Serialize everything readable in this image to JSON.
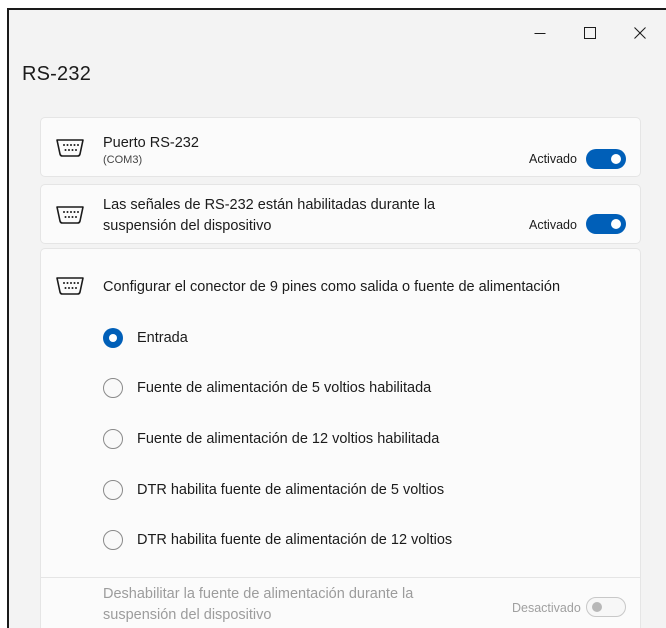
{
  "titlebar": {
    "minimize_glyph": "—",
    "maximize_glyph": "☐",
    "close_glyph": "✕"
  },
  "page": {
    "title": "RS-232"
  },
  "settings": [
    {
      "icon": "serial-port-icon",
      "title": "Puerto RS-232",
      "subtitle": "(COM3)",
      "state_label": "Activado",
      "toggle_on": true
    },
    {
      "icon": "serial-port-icon",
      "title": "Las señales de RS-232 están habilitadas durante la suspensión del dispositivo",
      "state_label": "Activado",
      "toggle_on": true
    }
  ],
  "connector": {
    "icon": "serial-port-icon",
    "title": "Configurar el conector de 9 pines como salida o fuente de alimentación",
    "options": [
      {
        "label": "Entrada",
        "selected": true
      },
      {
        "label": "Fuente de alimentación de 5 voltios habilitada",
        "selected": false
      },
      {
        "label": "Fuente de alimentación de 12 voltios habilitada",
        "selected": false
      },
      {
        "label": "DTR habilita fuente de alimentación de 5 voltios",
        "selected": false
      },
      {
        "label": "DTR habilita fuente de alimentación de 12 voltios",
        "selected": false
      }
    ],
    "disabled_setting": {
      "title": "Deshabilitar la fuente de alimentación durante la suspensión del dispositivo",
      "state_label": "Desactivado",
      "toggle_on": false,
      "enabled": false
    }
  },
  "colors": {
    "accent": "#005fb8",
    "background": "#f3f3f3",
    "card": "#fbfbfb",
    "disabled_text": "#9c9c9c"
  }
}
